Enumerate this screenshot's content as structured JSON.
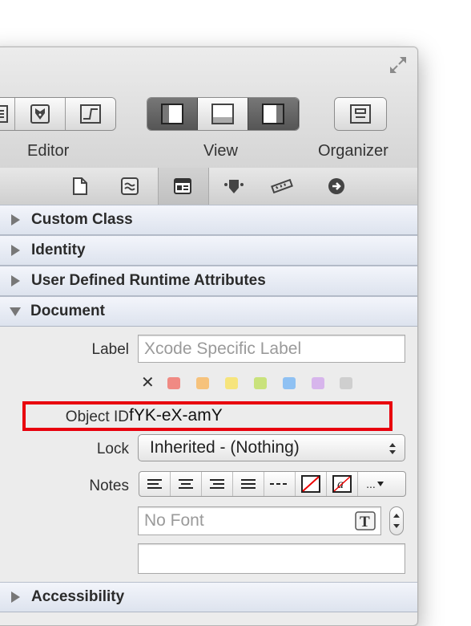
{
  "toolbar": {
    "editor_label": "Editor",
    "view_label": "View",
    "organizer_label": "Organizer"
  },
  "inspector_tabs": [
    "file-inspector-icon",
    "quick-help-icon",
    "identity-inspector-icon",
    "attributes-inspector-icon",
    "size-inspector-icon",
    "connections-inspector-icon"
  ],
  "sections": {
    "custom_class": "Custom Class",
    "identity": "Identity",
    "runtime_attributes": "User Defined Runtime Attributes",
    "document": "Document",
    "accessibility": "Accessibility"
  },
  "document": {
    "label_caption": "Label",
    "label_placeholder": "Xcode Specific Label",
    "label_colors": [
      "#f08a83",
      "#f6c27c",
      "#f6e47c",
      "#c9e27c",
      "#8fc1f3",
      "#d7b5ec",
      "#cfcfcf"
    ],
    "clear_color": "✕",
    "object_id_caption": "Object ID",
    "object_id_value": "fYK-eX-amY",
    "lock_caption": "Lock",
    "lock_value": "Inherited - (Nothing)",
    "notes_caption": "Notes",
    "font_value": "No Font",
    "more_menu": "..."
  },
  "colors": {
    "highlight": "#e8000d",
    "section_bg": "#dde3ee"
  }
}
